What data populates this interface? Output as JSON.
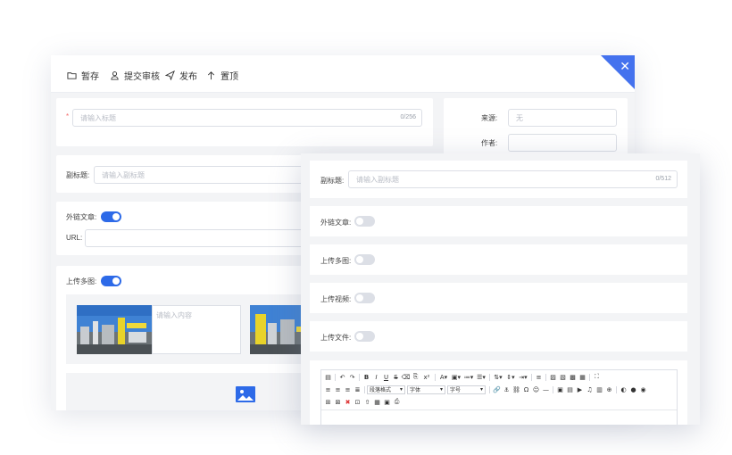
{
  "toolbar": {
    "draft": "暂存",
    "submit_review": "提交审核",
    "publish": "发布",
    "pin_top": "置顶"
  },
  "form": {
    "title_placeholder": "请输入标题",
    "title_counter": "0/256",
    "source_label": "来源:",
    "source_placeholder": "无",
    "author_label": "作者:",
    "subtitle_label": "副标题:",
    "subtitle_placeholder": "请输入副标题",
    "subtitle_counter": "0/512",
    "external_link_label": "外链文章:",
    "url_label": "URL:",
    "multi_image_label": "上传多图:",
    "image_caption_placeholder": "请输入内容",
    "upload_video_label": "上传视频:",
    "upload_file_label": "上传文件:"
  },
  "toggles": {
    "external_link_back": true,
    "multi_image_back": true,
    "external_link_front": false,
    "multi_image_front": false,
    "upload_video": false,
    "upload_file": false
  },
  "editor": {
    "paragraph_format": "段落格式",
    "font_family": "字体",
    "font_size": "字号"
  },
  "colors": {
    "accent": "#2d6ae8",
    "close_corner": "#4472ee",
    "required": "#f56c6c"
  }
}
